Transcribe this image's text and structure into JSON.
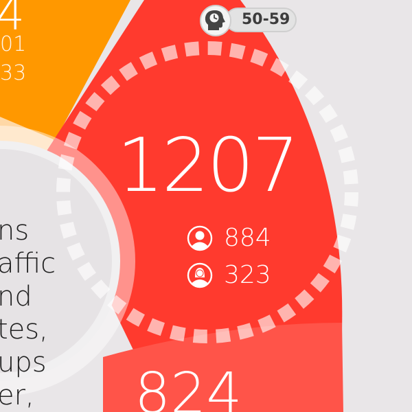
{
  "age_group": {
    "label": "50-59",
    "icon": "head-clock-icon"
  },
  "selected_segment": {
    "total": "1207",
    "male": {
      "icon": "male-user-icon",
      "value": "884"
    },
    "female": {
      "icon": "female-user-icon",
      "value": "323"
    },
    "color": "#ff3a2e"
  },
  "previous_segment": {
    "value_fragment": "4",
    "line1_fragment": "01",
    "line2_fragment": "33",
    "color": "#ff9800"
  },
  "next_segment": {
    "value_fragment": "824",
    "color": "#ff5a4e"
  },
  "center_text_lines": [
    "ns",
    "affic",
    "nd",
    "tes,",
    "ups",
    "er,"
  ],
  "colors": {
    "background": "#e9e6e8",
    "center": "#e6e3e5",
    "white": "#ffffff"
  }
}
